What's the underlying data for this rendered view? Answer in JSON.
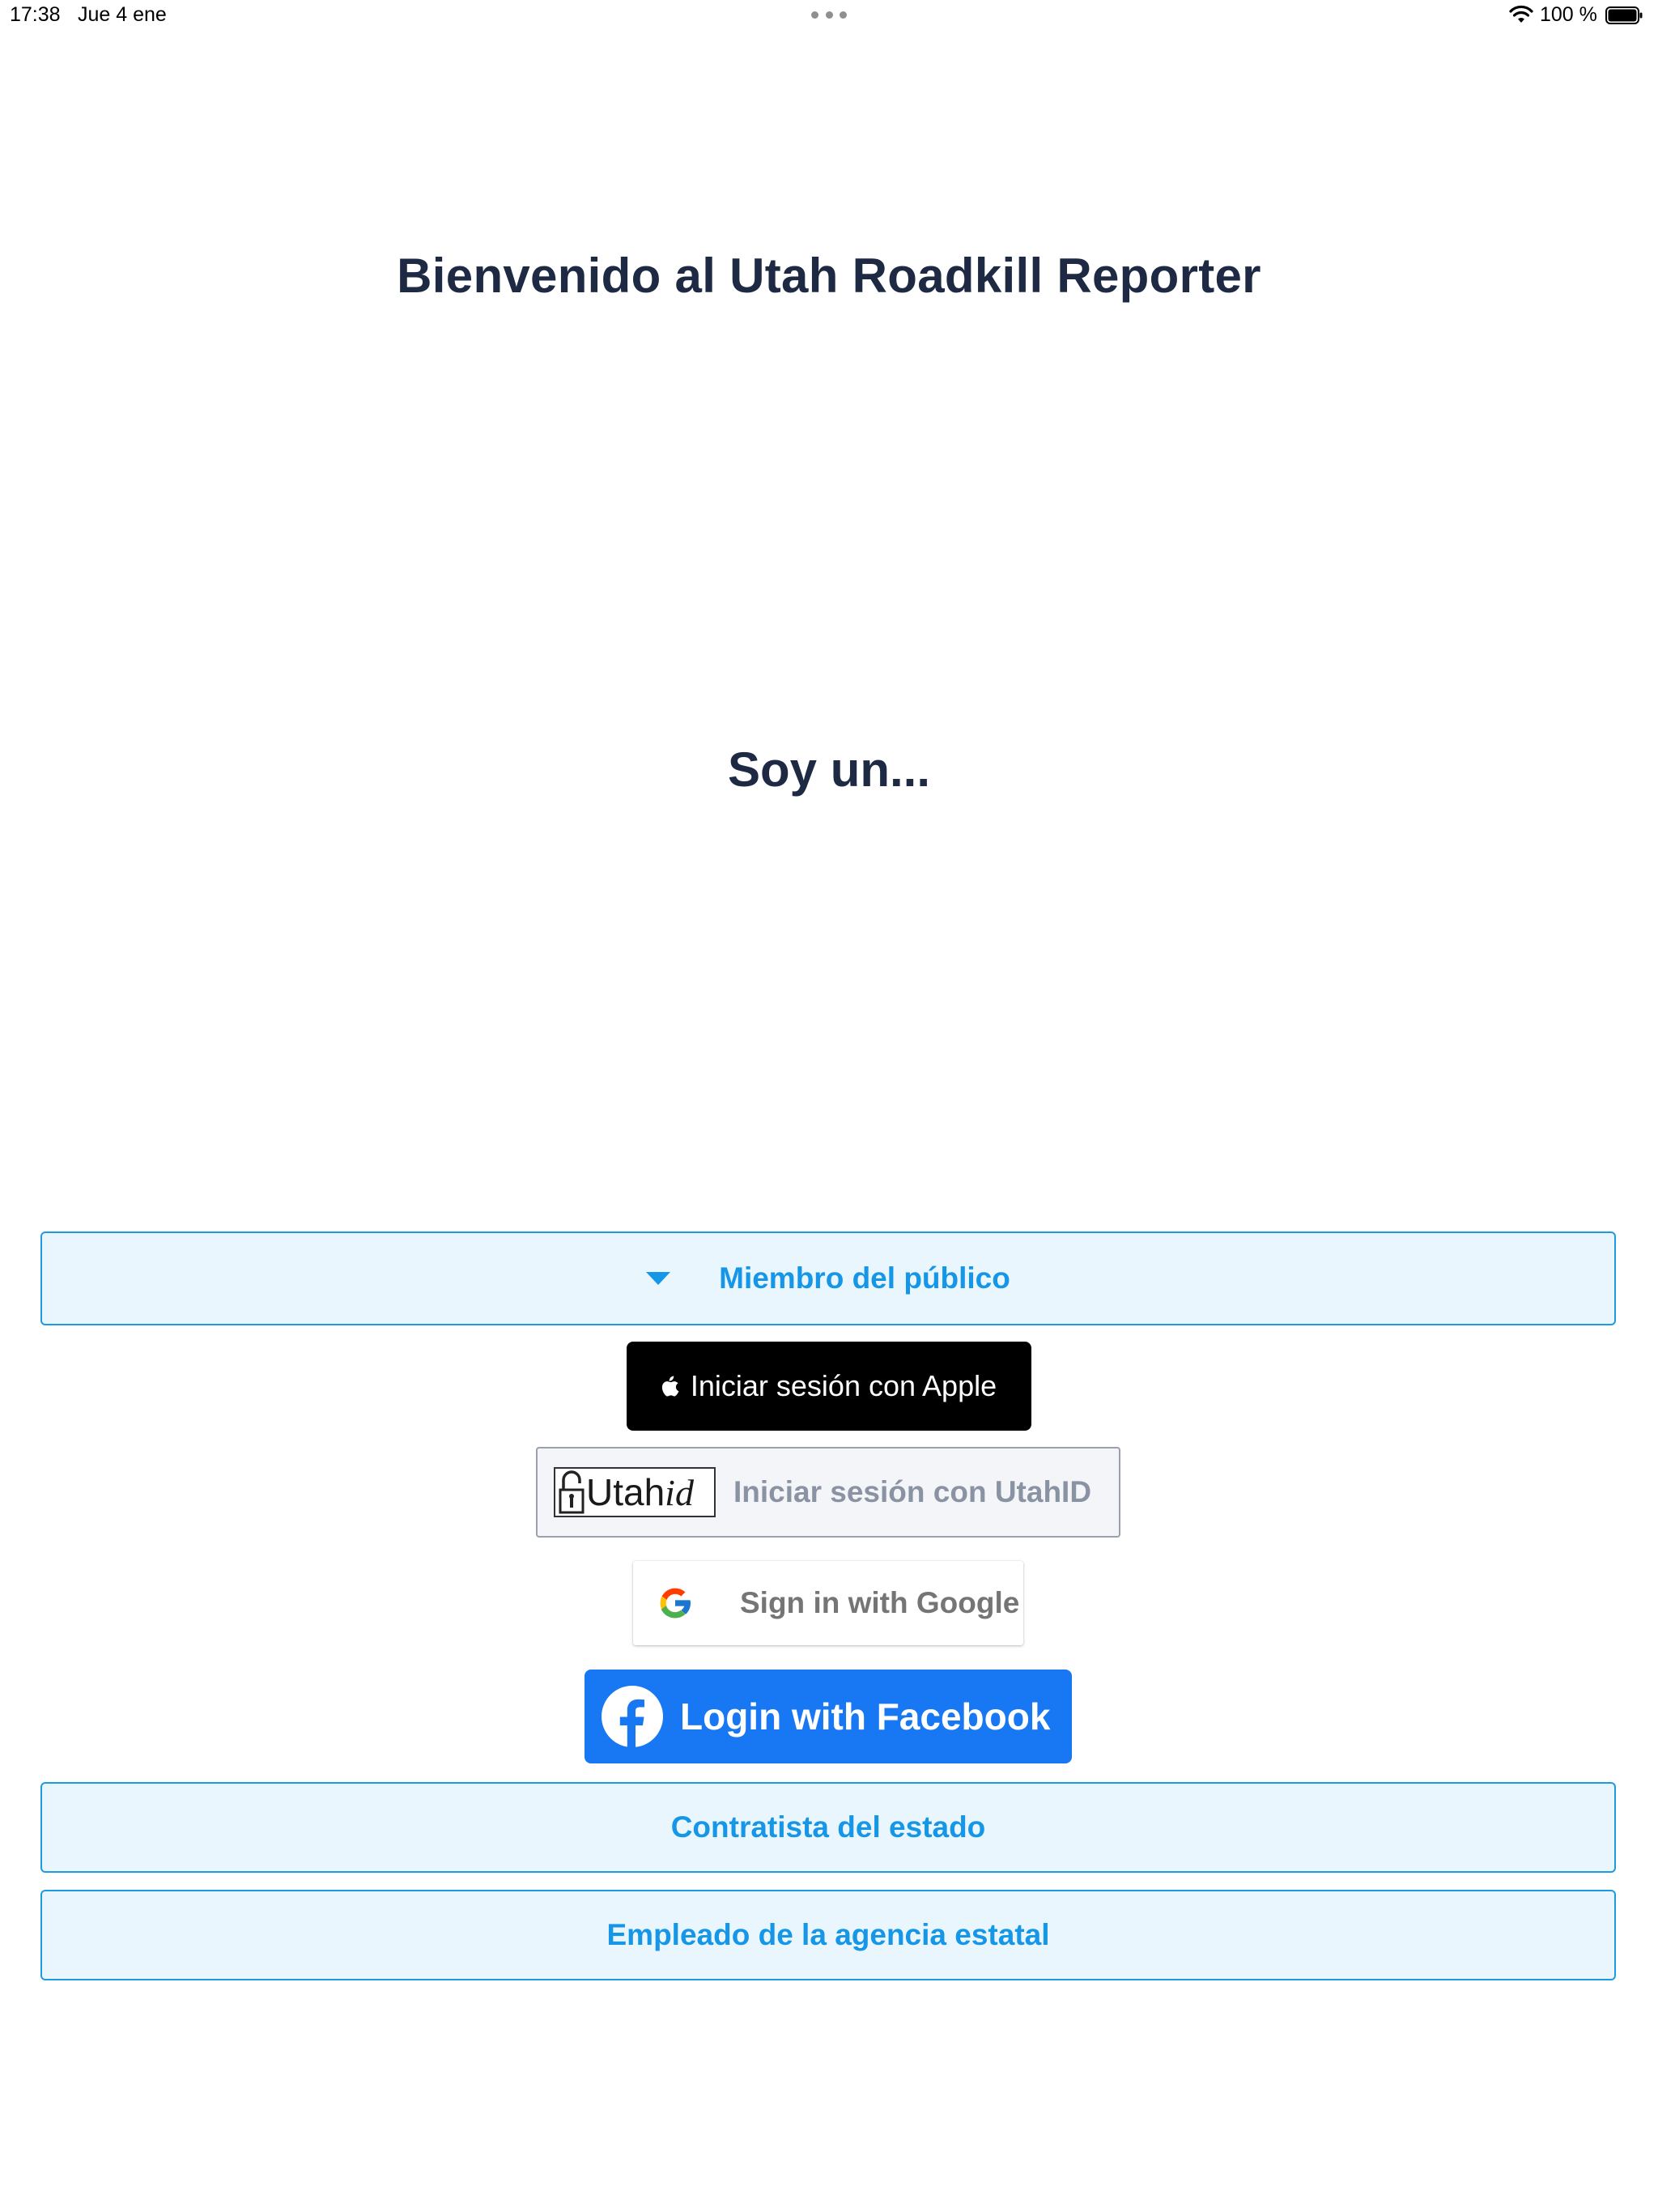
{
  "status_bar": {
    "time": "17:38",
    "date": "Jue 4 ene",
    "battery_text": "100 %",
    "icons": [
      "more-dots-icon",
      "wifi-icon",
      "battery-icon"
    ]
  },
  "title": "Bienvenido al Utah Roadkill Reporter",
  "subtitle": "Soy un...",
  "roles": {
    "public_label": "Miembro del público",
    "contractor_label": "Contratista del estado",
    "employee_label": "Empleado de la agencia estatal"
  },
  "login": {
    "apple_label": "Iniciar sesión con Apple",
    "utahid_logo_text": "Utah",
    "utahid_logo_italic": "id",
    "utahid_label": "Iniciar sesión con UtahID",
    "google_label": "Sign in with Google",
    "facebook_label": "Login with Facebook"
  },
  "colors": {
    "heading": "#1e2a44",
    "role_border": "#1e9be0",
    "role_fill": "#eaf6fd",
    "role_text": "#1596e6",
    "facebook_blue": "#1877f2",
    "apple_black": "#000000"
  }
}
